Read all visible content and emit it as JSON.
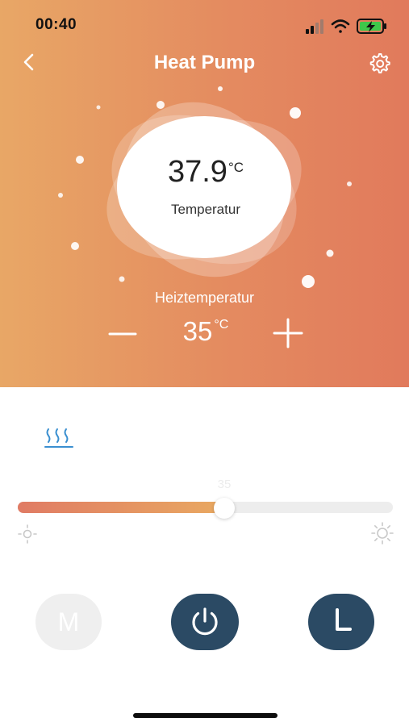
{
  "status_bar": {
    "time": "00:40",
    "icons": [
      "signal-icon",
      "wifi-icon",
      "battery-charging-icon"
    ],
    "battery_color": "#3ec84a"
  },
  "header": {
    "title": "Heat Pump",
    "back_icon": "chevron-left-icon",
    "settings_icon": "gear-icon"
  },
  "temperature": {
    "value": "37.9",
    "unit": "°C",
    "caption": "Temperatur"
  },
  "setpoint": {
    "label": "Heiztemperatur",
    "value": "35",
    "unit": "°C"
  },
  "slider": {
    "value": "35",
    "fill_fraction": 0.55,
    "min_icon": "sun-low-icon",
    "max_icon": "sun-high-icon"
  },
  "heat_mode_icon": "heat-waves-icon",
  "buttons": {
    "mode_label": "M",
    "power_icon": "power-icon",
    "timer_icon": "timer-L-icon"
  },
  "colors": {
    "gradient_left": "#e8a766",
    "gradient_right": "#e17a5c",
    "button_dark": "#2b4a64",
    "heat_icon": "#3a8fd0"
  }
}
